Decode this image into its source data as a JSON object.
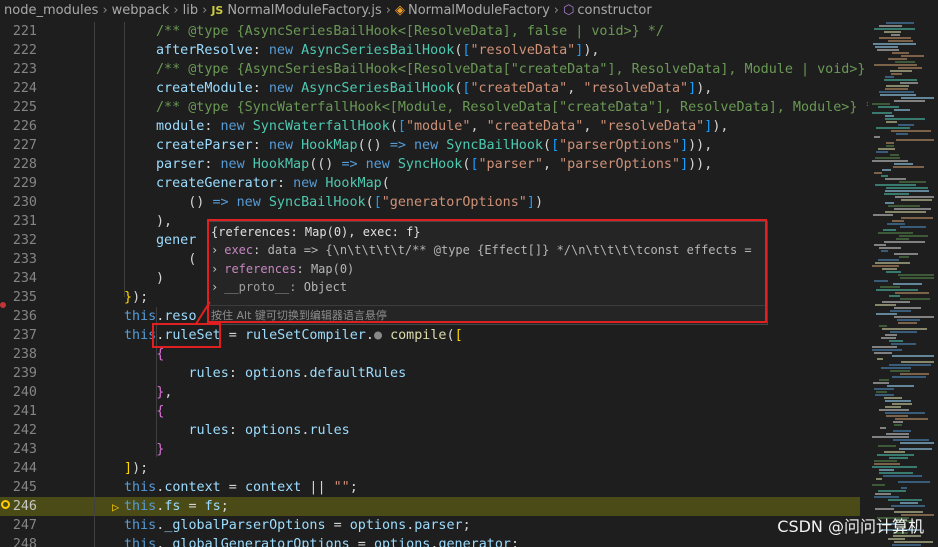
{
  "breadcrumb": {
    "parts": [
      "node_modules",
      "webpack",
      "lib"
    ],
    "file": "NormalModuleFactory.js",
    "file_icon": "JS",
    "class_name": "NormalModuleFactory",
    "member": "constructor"
  },
  "editor": {
    "lines": [
      {
        "n": "221",
        "html": "[c]/** @type {AsyncSeriesBailHook<[ResolveData], false | void>} */"
      },
      {
        "n": "222",
        "html": "[p]afterResolve[/]: [k]new[/] [t]AsyncSeriesBailHook[/]([b3][[/][s]\"resolveData\"[/][b3]][/]),"
      },
      {
        "n": "223",
        "html": "[c]/** @type {AsyncSeriesBailHook<[ResolveData[\"createData\"], ResolveData], Module | void>} */"
      },
      {
        "n": "224",
        "html": "[p]createModule[/]: [k]new[/] [t]AsyncSeriesBailHook[/]([b3][[/][s]\"createData\"[/], [s]\"resolveData\"[/][b3]][/]),"
      },
      {
        "n": "225",
        "html": "[c]/** @type {SyncWaterfallHook<[Module, ResolveData[\"createData\"], ResolveData], Module>} */"
      },
      {
        "n": "226",
        "html": "[p]module[/]: [k]new[/] [t]SyncWaterfallHook[/]([b3][[/][s]\"module\"[/], [s]\"createData\"[/], [s]\"resolveData\"[/][b3]][/]),"
      },
      {
        "n": "227",
        "html": "[p]createParser[/]: [k]new[/] [t]HookMap[/](() [k]=>[/] [k]new[/] [t]SyncBailHook[/]([b3][[/][s]\"parserOptions\"[/][b3]][/])),"
      },
      {
        "n": "228",
        "html": "[p]parser[/]: [k]new[/] [t]HookMap[/](() [k]=>[/] [k]new[/] [t]SyncHook[/]([b3][[/][s]\"parser\"[/], [s]\"parserOptions\"[/][b3]][/])),"
      },
      {
        "n": "229",
        "html": "[p]createGenerator[/]: [k]new[/] [t]HookMap[/]("
      },
      {
        "n": "230",
        "html": "    () [k]=>[/] [k]new[/] [t]SyncBailHook[/]([b3][[/][s]\"generatorOptions\"[/][b3]][/])"
      },
      {
        "n": "231",
        "html": "),"
      },
      {
        "n": "232",
        "html": "[p]gener[/]"
      },
      {
        "n": "233",
        "html": "    ("
      },
      {
        "n": "234",
        "html": ")"
      },
      {
        "n": "235",
        "html": "[b1]}[/]);"
      },
      {
        "n": "236",
        "html": "[k]this[/].[p]reso[/]"
      },
      {
        "n": "237",
        "html": "[k]this[/].[p]ruleSet[/] = [p]ruleSetCompiler[/].[dot] [f]compile[/]([b1][[/]"
      },
      {
        "n": "238",
        "html": "    [b2]{[/]"
      },
      {
        "n": "239",
        "html": "        [p]rules[/]: [p]options[/].[p]defaultRules[/]"
      },
      {
        "n": "240",
        "html": "    [b2]}[/],"
      },
      {
        "n": "241",
        "html": "    [b2]{[/]"
      },
      {
        "n": "242",
        "html": "        [p]rules[/]: [p]options[/].[p]rules[/]"
      },
      {
        "n": "243",
        "html": "    [b2]}[/]"
      },
      {
        "n": "244",
        "html": "[b1]][/]);"
      },
      {
        "n": "245",
        "html": "[k]this[/].[p]context[/] = [p]context[/] || [s]\"\"[/];"
      },
      {
        "n": "246",
        "html": "[k]this[/].[p]fs[/] = [p]fs[/];"
      },
      {
        "n": "247",
        "html": "[k]this[/].[p]_globalParserOptions[/] = [p]options[/].[p]parser[/];"
      },
      {
        "n": "248",
        "html": "[k]this[/].[p]_globalGeneratorOptions[/] = [p]options[/].[p]generator[/];"
      }
    ]
  },
  "hover": {
    "header": "{references: Map(0), exec: f}",
    "rows": [
      {
        "key": "exec",
        "value": "data => {\\n\\t\\t\\t\\t/** @type {Effect[]} */\\n\\t\\t\\t\\tconst effects ="
      },
      {
        "key": "references",
        "value": "Map(0)"
      },
      {
        "key": "__proto__",
        "value": "Object"
      }
    ],
    "footer": "按住 Alt 键可切换到编辑器语言悬停"
  },
  "watermark": "CSDN @问问计算机",
  "colors": {
    "highlight_line": "#4b4b18",
    "annotation": "#e02020",
    "background": "#1e1e1e"
  }
}
